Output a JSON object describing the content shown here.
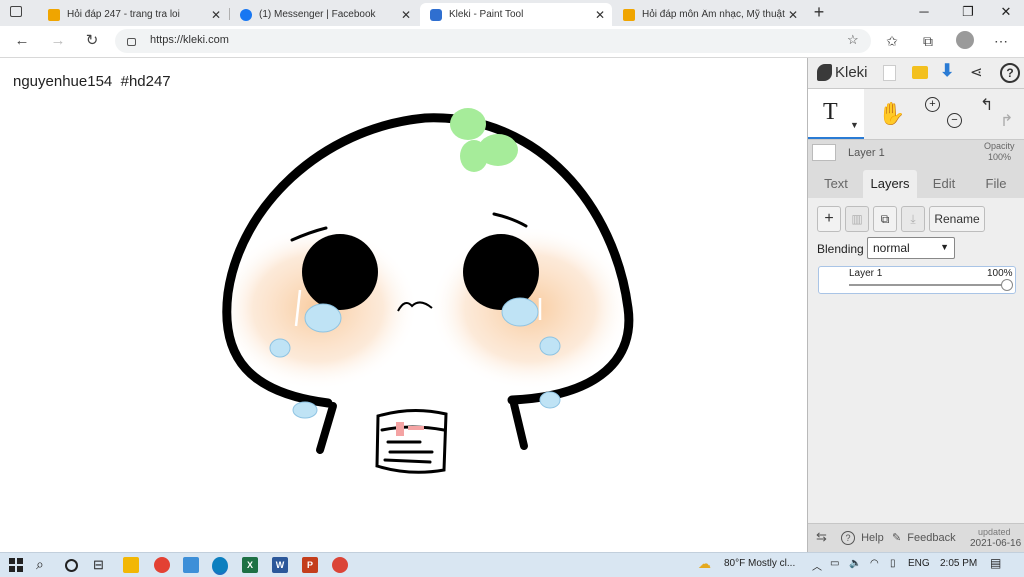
{
  "browser": {
    "tabs": [
      {
        "title": "Hỏi đáp 247 - trang tra loi",
        "favicon": "hd247-icon",
        "color": "#f0a500"
      },
      {
        "title": "(1) Messenger | Facebook",
        "favicon": "facebook-icon",
        "color": "#1877f2"
      },
      {
        "title": "Kleki - Paint Tool",
        "favicon": "kleki-icon",
        "color": "#2f6fd0"
      },
      {
        "title": "Hỏi đáp môn Âm nhạc, Mỹ thuật",
        "favicon": "hd247-icon",
        "color": "#f0a500"
      }
    ],
    "active_tab": 2,
    "new_tab": "+",
    "url": "https://kleki.com"
  },
  "canvas": {
    "signature": "nguyenhue154  #hd247"
  },
  "kleki": {
    "logo": "Kleki",
    "layer_name": "Layer 1",
    "opacity_label": "Opacity",
    "opacity_value": "100%",
    "tabs": [
      "Text",
      "Layers",
      "Edit",
      "File"
    ],
    "active_tab": "Layers",
    "rename_label": "Rename",
    "blending_label": "Blending",
    "blending_value": "normal",
    "layer_row_name": "Layer 1",
    "layer_row_opacity": "100%",
    "help_label": "Help",
    "feedback_label": "Feedback",
    "updated_label": "updated",
    "updated_date": "2021-06-16",
    "accent": "#2a7bd4"
  },
  "taskbar": {
    "weather": "80°F  Mostly cl...",
    "lang": "ENG",
    "time": "2:05 PM",
    "apps": [
      {
        "name": "file-explorer-icon",
        "color": "#f2b705",
        "glyph": ""
      },
      {
        "name": "chrome-icon",
        "color": "#e34133",
        "glyph": ""
      },
      {
        "name": "computer-icon",
        "color": "#3d8fd8",
        "glyph": ""
      },
      {
        "name": "edge-icon",
        "color": "#0c7fbf",
        "glyph": ""
      },
      {
        "name": "excel-icon",
        "color": "#1d7044",
        "glyph": "X"
      },
      {
        "name": "word-icon",
        "color": "#2b579a",
        "glyph": "W"
      },
      {
        "name": "powerpoint-icon",
        "color": "#c43e1c",
        "glyph": "P"
      },
      {
        "name": "google-chrome-icon",
        "color": "#db4437",
        "glyph": ""
      }
    ]
  }
}
